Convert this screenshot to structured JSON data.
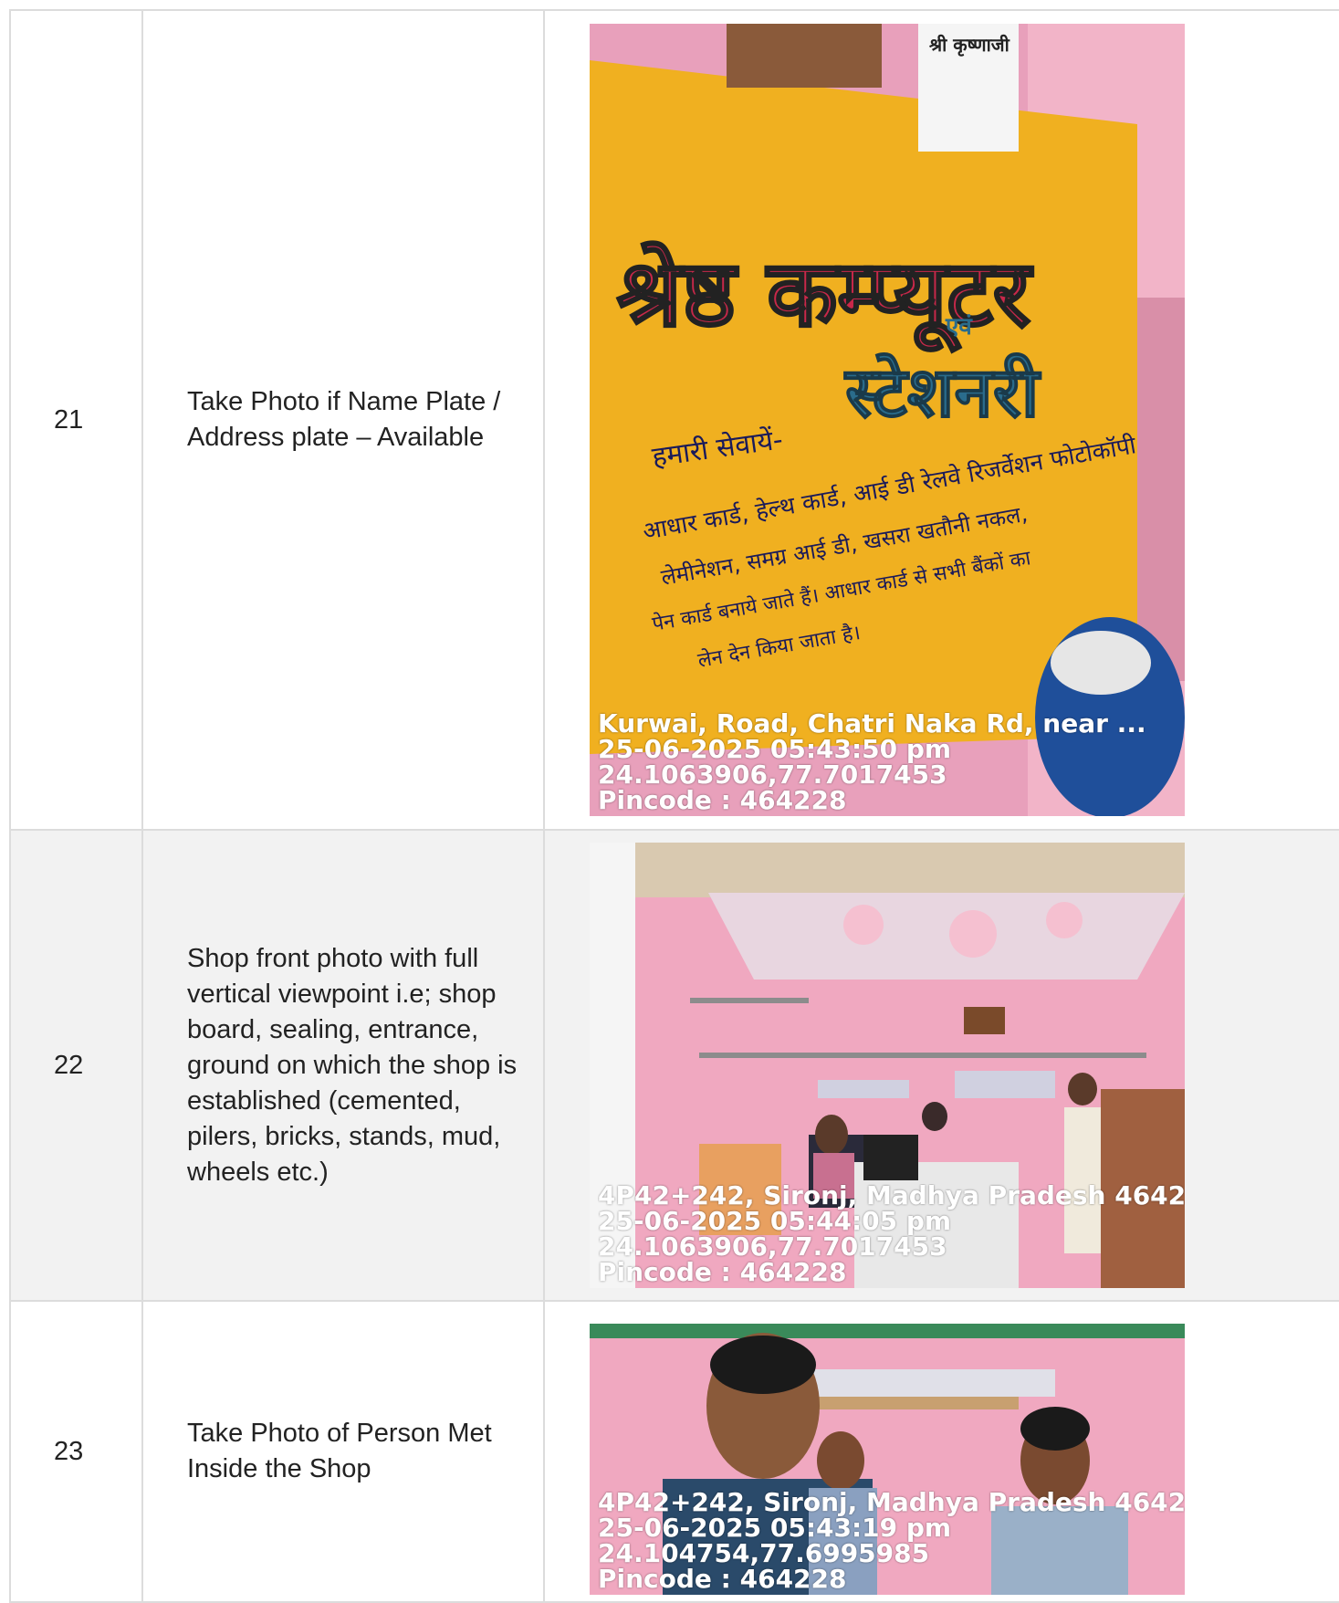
{
  "rows": [
    {
      "number": "21",
      "label": "Take Photo if Name Plate / Address plate – Available",
      "photo": {
        "subject": "shop-name-board",
        "stamp": {
          "address": "Kurwai, Road, Chatri Naka Rd, near ...",
          "datetime": "25-06-2025 05:43:50 pm",
          "coords": "24.1063906,77.7017453",
          "pincode": "Pincode : 464228"
        },
        "board": {
          "line1": "श्रेष्ठ कम्प्यूटर",
          "line2": "एवं",
          "line3": "स्टेशनरी",
          "line4": "हमारी सेवायें-",
          "line5": "आधार कार्ड, हेल्थ कार्ड, आई डी रेलवे रिजर्वेशन फोटोकॉपी",
          "line6": "लेमीनेशन, समग्र आई डी, खसरा खतौनी नकल,",
          "line7": "पेन कार्ड बनाये जाते हैं। आधार कार्ड से सभी बैंकों का",
          "line8": "लेन देन किया जाता है।",
          "poster": "श्री कृष्णाजी"
        }
      }
    },
    {
      "number": "22",
      "label": "Shop front photo with full vertical viewpoint i.e; shop board, sealing, entrance, ground on which the shop is established (cemented, pilers, bricks, stands, mud, wheels etc.)",
      "photo": {
        "subject": "shop-interior",
        "stamp": {
          "address": "4P42+242, Sironj, Madhya Pradesh 4642",
          "datetime": "25-06-2025 05:44:05 pm",
          "coords": "24.1063906,77.7017453",
          "pincode": "Pincode : 464228"
        }
      }
    },
    {
      "number": "23",
      "label": "Take Photo of Person Met Inside the Shop",
      "photo": {
        "subject": "persons-met",
        "stamp": {
          "address": "4P42+242, Sironj, Madhya Pradesh 4642",
          "datetime": "25-06-2025 05:43:19 pm",
          "coords": "24.104754,77.6995985",
          "pincode": "Pincode : 464228"
        }
      }
    }
  ],
  "colors": {
    "border": "#dcdcdc",
    "row_alt": "#f2f2f2",
    "wall_pink": "#f0a8c0",
    "board_yellow": "#f0b020",
    "stamp_text": "#ffffff"
  }
}
